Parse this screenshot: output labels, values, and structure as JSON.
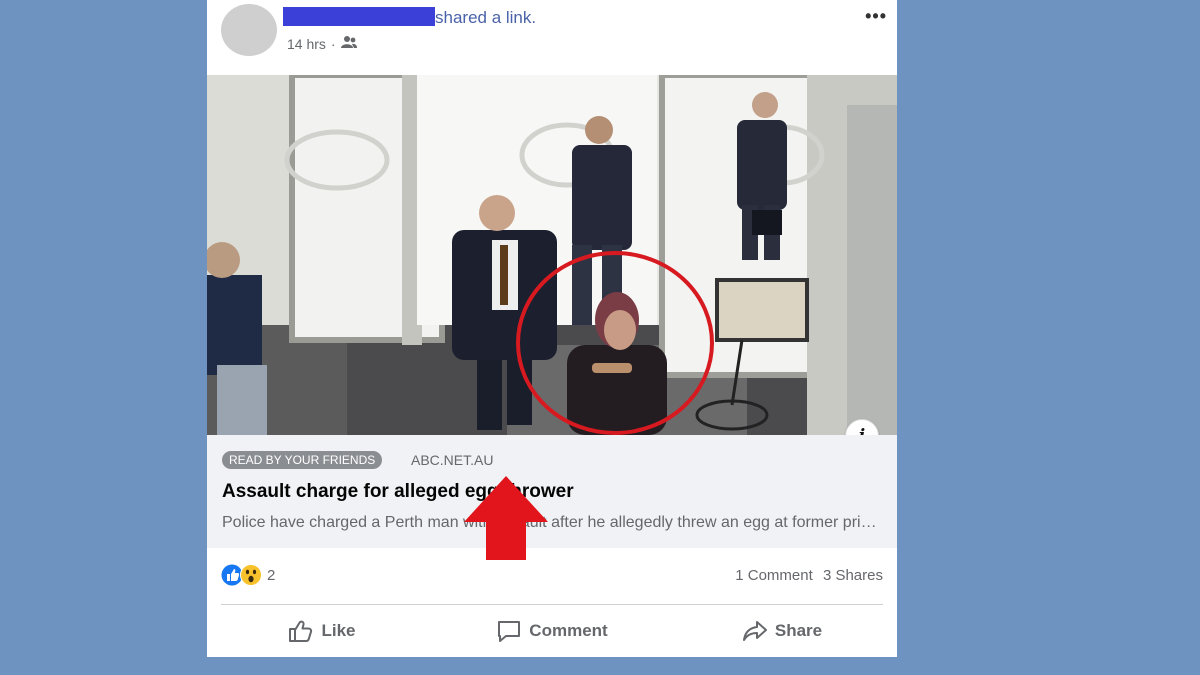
{
  "post": {
    "shared_text": "shared a link.",
    "time": "14 hrs",
    "time_separator": "·",
    "more_label": "•••"
  },
  "link": {
    "badge": "READ BY YOUR FRIENDS",
    "domain": "ABC.NET.AU",
    "title": "Assault charge for alleged egg thrower",
    "description": "Police have charged a Perth man with assault after he allegedly threw an egg at former prime minister Julia Gillard",
    "info_label": "i"
  },
  "stats": {
    "reaction_count": "2",
    "comments": "1 Comment",
    "shares": "3 Shares"
  },
  "actions": {
    "like": "Like",
    "comment": "Comment",
    "share": "Share"
  },
  "colors": {
    "page_bg": "#6f93c1",
    "redaction": "#3b40d9",
    "circle_highlight": "#d71920",
    "arrow": "#e3151c"
  },
  "icons": {
    "audience": "friends-icon",
    "like": "thumbs-up-icon",
    "comment": "speech-bubble-icon",
    "share": "share-arrow-icon",
    "reaction_like": "like-reaction-icon",
    "reaction_wow": "wow-reaction-icon"
  }
}
